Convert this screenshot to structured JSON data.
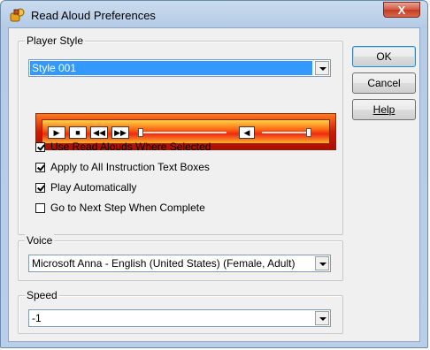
{
  "window": {
    "title": "Read Aloud Preferences",
    "close_label": "X"
  },
  "player_style": {
    "group_label": "Player Style",
    "selected_value": "Style 001",
    "preview_controls": [
      "play-icon",
      "stop-icon",
      "rewind-icon",
      "fast-forward-icon"
    ],
    "volume_icon": "speaker-icon"
  },
  "options": [
    {
      "label": "Use Read Alouds Where Selected",
      "checked": true
    },
    {
      "label": "Apply to All Instruction Text Boxes",
      "checked": true
    },
    {
      "label": "Play Automatically",
      "checked": true
    },
    {
      "label": "Go to Next Step When Complete",
      "checked": false
    }
  ],
  "voice": {
    "group_label": "Voice",
    "selected_value": "Microsoft Anna - English (United States) (Female, Adult)"
  },
  "speed": {
    "group_label": "Speed",
    "selected_value": "-1"
  },
  "buttons": {
    "ok": "OK",
    "cancel": "Cancel",
    "help": "Help"
  },
  "colors": {
    "selection": "#3399ff",
    "player_orange": "#ff7a1a",
    "player_red": "#d01a08"
  }
}
